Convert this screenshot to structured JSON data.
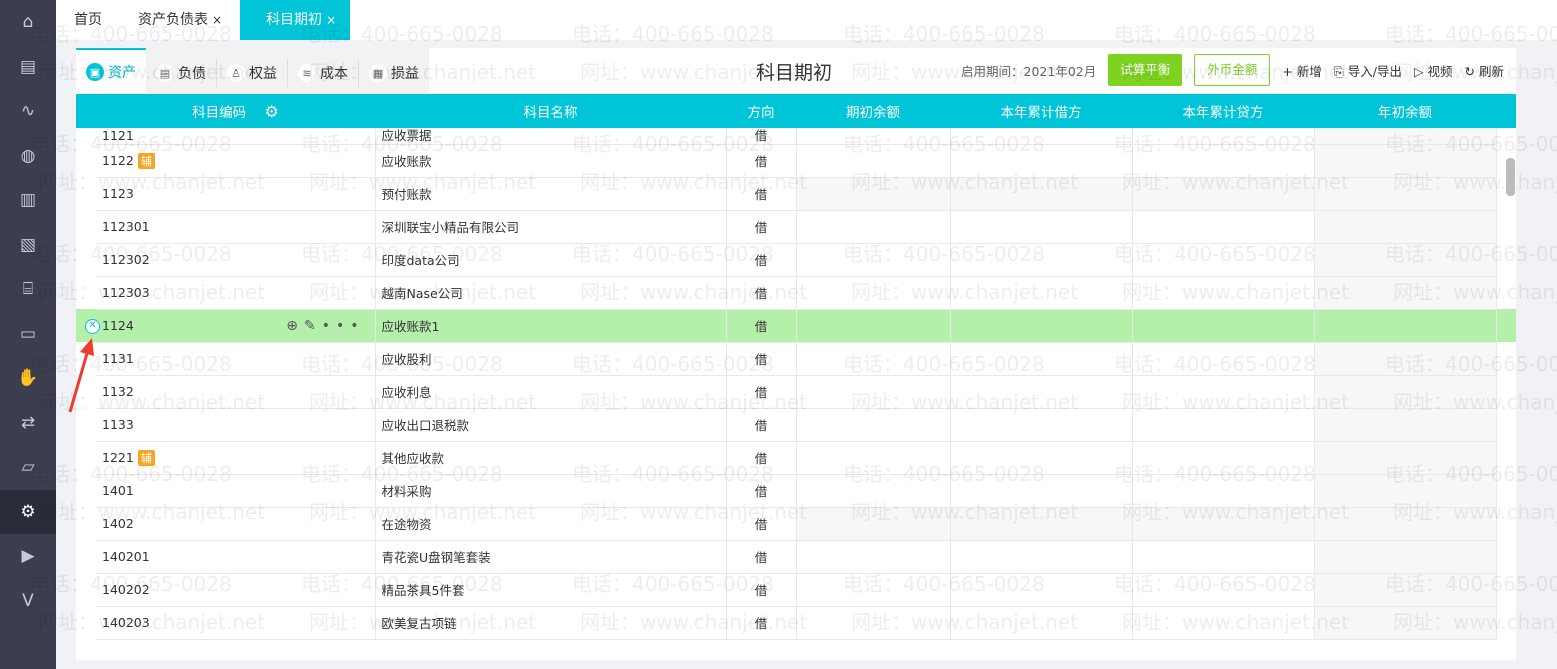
{
  "sidebar": {
    "items": [
      "home-icon",
      "invoice-icon",
      "chart-icon",
      "money-bag-icon",
      "building-icon",
      "report-icon",
      "store-icon",
      "presentation-icon",
      "hand-icon",
      "exchange-icon",
      "inbox-icon",
      "gear-icon",
      "video-icon",
      "v-icon"
    ],
    "active": 11
  },
  "tabs": [
    {
      "label": "首页"
    },
    {
      "label": "资产负债表",
      "close": "×"
    },
    {
      "label": "科目期初",
      "close": "×",
      "active": true
    }
  ],
  "subtabs": [
    {
      "label": "资产",
      "active": true
    },
    {
      "label": "负债"
    },
    {
      "label": "权益"
    },
    {
      "label": "成本"
    },
    {
      "label": "损益"
    }
  ],
  "page_title": "科目期初",
  "toolbar": {
    "period": "启用期间：2021年02月",
    "trial_balance": "试算平衡",
    "foreign_currency": "外币金额",
    "add": "+ 新增",
    "import_export": "导入/导出",
    "video": "视频",
    "refresh": "刷新"
  },
  "table": {
    "headers": [
      "科目编码",
      "科目名称",
      "方向",
      "期初余额",
      "本年累计借方",
      "本年累计贷方",
      "年初余额"
    ],
    "rows": [
      {
        "code": "1121",
        "name": "应收票据",
        "dir": "借"
      },
      {
        "code": "1122",
        "aux": "辅",
        "name": "应收账款",
        "dir": "借"
      },
      {
        "code": "1123",
        "name": "预付账款",
        "dir": "借",
        "grey": true
      },
      {
        "code": "112301",
        "name": "深圳联宝小精品有限公司",
        "dir": "借"
      },
      {
        "code": "112302",
        "name": "印度data公司",
        "dir": "借"
      },
      {
        "code": "112303",
        "name": "越南Nase公司",
        "dir": "借"
      },
      {
        "code": "1124",
        "name": "应收账款1",
        "dir": "借",
        "highlight": true
      },
      {
        "code": "1131",
        "name": "应收股利",
        "dir": "借"
      },
      {
        "code": "1132",
        "name": "应收利息",
        "dir": "借"
      },
      {
        "code": "1133",
        "name": "应收出口退税款",
        "dir": "借"
      },
      {
        "code": "1221",
        "aux": "辅",
        "name": "其他应收款",
        "dir": "借"
      },
      {
        "code": "1401",
        "name": "材料采购",
        "dir": "借"
      },
      {
        "code": "1402",
        "name": "在途物资",
        "dir": "借",
        "grey": true
      },
      {
        "code": "140201",
        "name": "青花瓷U盘钢笔套装",
        "dir": "借"
      },
      {
        "code": "140202",
        "name": "精品茶具5件套",
        "dir": "借"
      },
      {
        "code": "140203",
        "name": "欧美复古项链",
        "dir": "借"
      }
    ]
  },
  "watermark": {
    "phone": "电话：400-665-0028",
    "site": "网址：www.chanjet.net"
  },
  "colors": {
    "accent": "#00c4d8",
    "green": "#7ed321",
    "highlight": "#b4f0aa",
    "aux": "#f5a623"
  }
}
